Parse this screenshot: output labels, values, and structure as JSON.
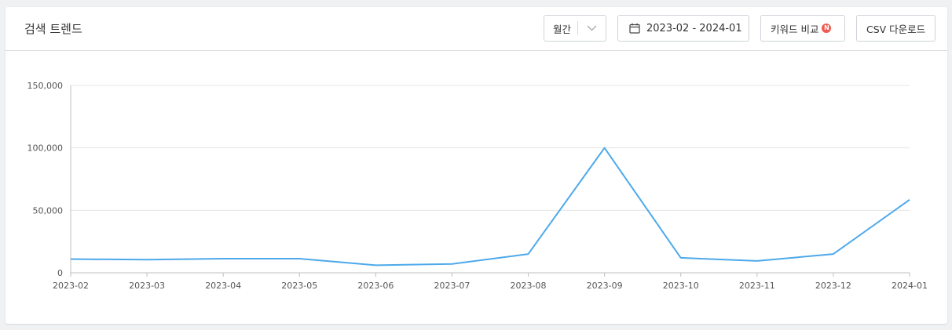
{
  "header": {
    "title": "검색 트렌드",
    "period_select": {
      "selected": "월간"
    },
    "date_range": "2023-02 - 2024-01",
    "compare_button": {
      "label": "키워드 비교",
      "badge": "N"
    },
    "csv_button": "CSV 다운로드"
  },
  "colors": {
    "line": "#4da9ea",
    "grid": "#e5e5e5",
    "axis": "#bfbfbf",
    "badge": "#f05a50"
  },
  "chart_data": {
    "type": "line",
    "categories": [
      "2023-02",
      "2023-03",
      "2023-04",
      "2023-05",
      "2023-06",
      "2023-07",
      "2023-08",
      "2023-09",
      "2023-10",
      "2023-11",
      "2023-12",
      "2024-01"
    ],
    "series": [
      {
        "values": [
          11000,
          10500,
          11300,
          11300,
          6000,
          7000,
          15000,
          100000,
          12000,
          9500,
          15000,
          58500
        ]
      }
    ],
    "yticks": [
      "0",
      "50,000",
      "100,000",
      "150,000"
    ],
    "ylim": [
      0,
      150000
    ],
    "grid": true,
    "legend": "none"
  }
}
